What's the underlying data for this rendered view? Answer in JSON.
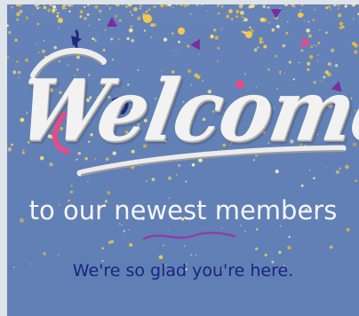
{
  "card": {
    "headline": "Welcome",
    "subtitle": "to our newest members",
    "tagline": "We're so glad you're here."
  },
  "colors": {
    "background": "#6281b6",
    "headline": "#f2f2f2",
    "subtitle": "#f5f5f5",
    "tagline": "#1a237e",
    "confetti_gold": "#f2c94c",
    "confetti_pink": "#e24c8a",
    "confetti_purple": "#7b2d9e",
    "divider": "#8e3fa8"
  },
  "icons": {
    "confetti": "confetti-icon",
    "divider": "wave-divider-icon",
    "swash": "swash-icon"
  }
}
